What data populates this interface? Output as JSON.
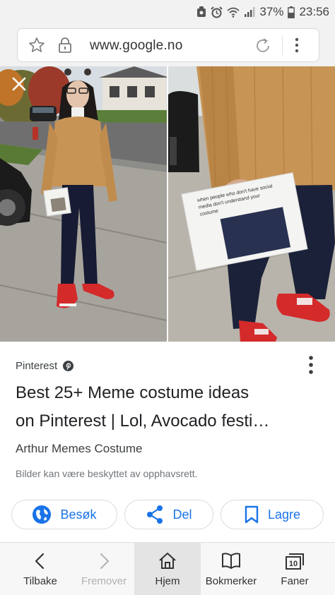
{
  "status_bar": {
    "battery": "37%",
    "time": "23:56"
  },
  "address_bar": {
    "url": "www.google.no",
    "icons": [
      "star-icon",
      "lock-icon",
      "reload-icon",
      "overflow-menu-icon"
    ]
  },
  "image": {
    "close_icon": "close-icon",
    "sign_text_small": [
      "when people who",
      "don't have social",
      "media don't"
    ],
    "sign_text_large": [
      "when people who don't have social",
      "media don't understand your",
      "costume"
    ]
  },
  "result": {
    "source": "Pinterest",
    "title_line1": "Best 25+ Meme costume ideas",
    "title_line2": "on Pinterest | Lol, Avocado festi…",
    "subtitle": "Arthur Memes Costume",
    "copyright": "Bilder kan være beskyttet av opphavsrett."
  },
  "actions": {
    "visit": "Besøk",
    "share": "Del",
    "save": "Lagre"
  },
  "bottom_nav": {
    "back": "Tilbake",
    "forward": "Fremover",
    "home": "Hjem",
    "bookmarks": "Bokmerker",
    "tabs": "Faner",
    "tab_count": "10"
  },
  "colors": {
    "accent": "#1a73e8",
    "sweater": "#c89455",
    "sneakers": "#d42a2a"
  }
}
